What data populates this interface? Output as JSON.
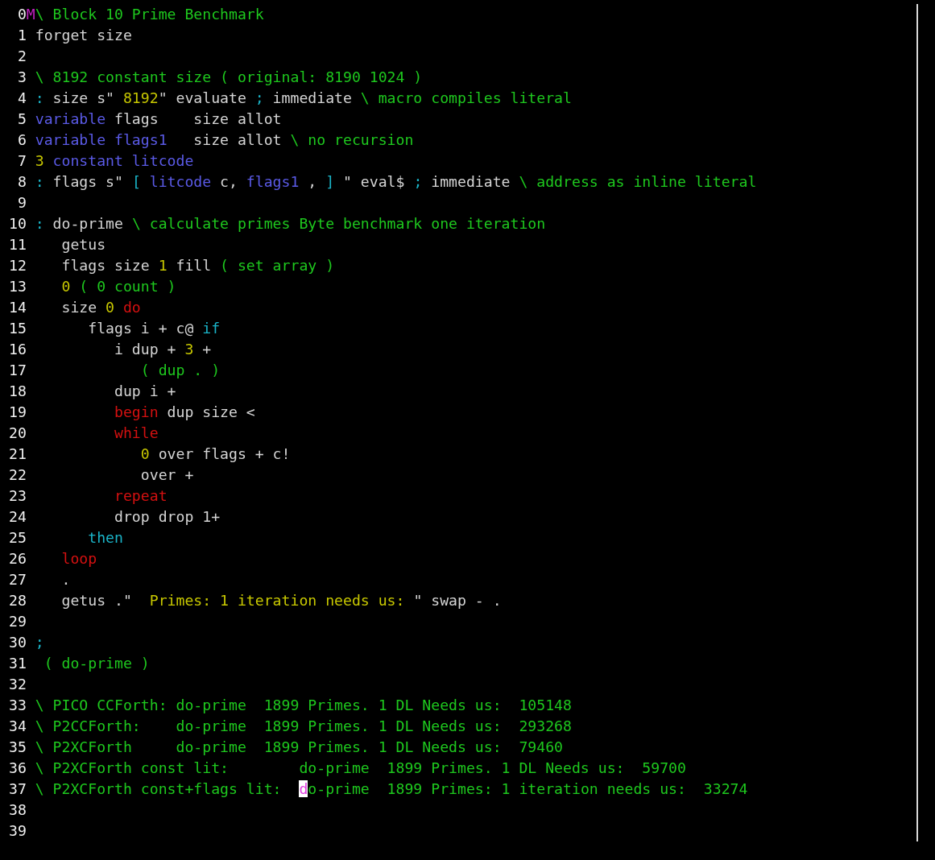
{
  "lines": [
    {
      "number": "0",
      "mark": "M",
      "segments": [
        {
          "text": "\\ Block 10 Prime Benchmark",
          "kind": "comment",
          "cursor": false
        }
      ]
    },
    {
      "number": "1",
      "segments": [
        {
          "text": "forget size",
          "kind": "word",
          "cursor": false
        }
      ]
    },
    {
      "number": "2"
    },
    {
      "number": "3",
      "segments": [
        {
          "text": "\\ 8192 constant size ( original: 8190 1024 )",
          "kind": "comment",
          "cursor": false
        }
      ]
    },
    {
      "number": "4",
      "segments": [
        {
          "text": ":",
          "kind": "structure",
          "cursor": false
        },
        {
          "text": " size s\" ",
          "kind": "word",
          "cursor": false
        },
        {
          "text": "8192",
          "kind": "number",
          "cursor": false
        },
        {
          "text": "\" evaluate ",
          "kind": "word",
          "cursor": false
        },
        {
          "text": ";",
          "kind": "structure",
          "cursor": false
        },
        {
          "text": " immediate ",
          "kind": "word",
          "cursor": false
        },
        {
          "text": "\\ macro compiles literal",
          "kind": "comment",
          "cursor": false
        }
      ]
    },
    {
      "number": "5",
      "segments": [
        {
          "text": "variable",
          "kind": "defining",
          "cursor": false
        },
        {
          "text": " flags    size allot",
          "kind": "word",
          "cursor": false
        }
      ]
    },
    {
      "number": "6",
      "segments": [
        {
          "text": "variable flags1",
          "kind": "defining",
          "cursor": false
        },
        {
          "text": "   size allot ",
          "kind": "word",
          "cursor": false
        },
        {
          "text": "\\ no recursion",
          "kind": "comment",
          "cursor": false
        }
      ]
    },
    {
      "number": "7",
      "segments": [
        {
          "text": "3 ",
          "kind": "number",
          "cursor": false
        },
        {
          "text": "constant litcode",
          "kind": "defining",
          "cursor": false
        }
      ]
    },
    {
      "number": "8",
      "segments": [
        {
          "text": ":",
          "kind": "structure",
          "cursor": false
        },
        {
          "text": " flags s\" ",
          "kind": "word",
          "cursor": false
        },
        {
          "text": "[ ",
          "kind": "structure",
          "cursor": false
        },
        {
          "text": "litcode",
          "kind": "defining",
          "cursor": false
        },
        {
          "text": " c, ",
          "kind": "word",
          "cursor": false
        },
        {
          "text": "flags1",
          "kind": "defining",
          "cursor": false
        },
        {
          "text": " , ",
          "kind": "word",
          "cursor": false
        },
        {
          "text": "]",
          "kind": "structure",
          "cursor": false
        },
        {
          "text": " \" eval$ ",
          "kind": "word",
          "cursor": false
        },
        {
          "text": ";",
          "kind": "structure",
          "cursor": false
        },
        {
          "text": " immediate ",
          "kind": "word",
          "cursor": false
        },
        {
          "text": "\\ address as inline literal",
          "kind": "comment",
          "cursor": false
        }
      ]
    },
    {
      "number": "9"
    },
    {
      "number": "10",
      "segments": [
        {
          "text": ":",
          "kind": "structure",
          "cursor": false
        },
        {
          "text": " do-prime ",
          "kind": "word",
          "cursor": false
        },
        {
          "text": "\\ calculate primes Byte benchmark one iteration",
          "kind": "comment",
          "cursor": false
        }
      ]
    },
    {
      "number": "11",
      "segments": [
        {
          "text": "   getus",
          "kind": "word",
          "cursor": false
        }
      ]
    },
    {
      "number": "12",
      "segments": [
        {
          "text": "   flags size ",
          "kind": "word",
          "cursor": false
        },
        {
          "text": "1",
          "kind": "number",
          "cursor": false
        },
        {
          "text": " fill ",
          "kind": "word",
          "cursor": false
        },
        {
          "text": "( set array )",
          "kind": "comment",
          "cursor": false
        }
      ]
    },
    {
      "number": "13",
      "segments": [
        {
          "text": "   0 ",
          "kind": "number",
          "cursor": false
        },
        {
          "text": "( 0 count )",
          "kind": "comment",
          "cursor": false
        }
      ]
    },
    {
      "number": "14",
      "segments": [
        {
          "text": "   size ",
          "kind": "word",
          "cursor": false
        },
        {
          "text": "0 ",
          "kind": "number",
          "cursor": false
        },
        {
          "text": "do",
          "kind": "control",
          "cursor": false
        }
      ]
    },
    {
      "number": "15",
      "segments": [
        {
          "text": "      flags i + c@ ",
          "kind": "word",
          "cursor": false
        },
        {
          "text": "if",
          "kind": "structure",
          "cursor": false
        }
      ]
    },
    {
      "number": "16",
      "segments": [
        {
          "text": "         i dup + ",
          "kind": "word",
          "cursor": false
        },
        {
          "text": "3",
          "kind": "number",
          "cursor": false
        },
        {
          "text": " +",
          "kind": "word",
          "cursor": false
        }
      ]
    },
    {
      "number": "17",
      "segments": [
        {
          "text": "            ( dup . )",
          "kind": "comment",
          "cursor": false
        }
      ]
    },
    {
      "number": "18",
      "segments": [
        {
          "text": "         dup i +",
          "kind": "word",
          "cursor": false
        }
      ]
    },
    {
      "number": "19",
      "segments": [
        {
          "text": "         begin",
          "kind": "control",
          "cursor": false
        },
        {
          "text": " dup size <",
          "kind": "word",
          "cursor": false
        }
      ]
    },
    {
      "number": "20",
      "segments": [
        {
          "text": "         while",
          "kind": "control",
          "cursor": false
        }
      ]
    },
    {
      "number": "21",
      "segments": [
        {
          "text": "            0",
          "kind": "number",
          "cursor": false
        },
        {
          "text": " over flags + c!",
          "kind": "word",
          "cursor": false
        }
      ]
    },
    {
      "number": "22",
      "segments": [
        {
          "text": "            over +",
          "kind": "word",
          "cursor": false
        }
      ]
    },
    {
      "number": "23",
      "segments": [
        {
          "text": "         repeat",
          "kind": "control",
          "cursor": false
        }
      ]
    },
    {
      "number": "24",
      "segments": [
        {
          "text": "         drop drop 1+",
          "kind": "word",
          "cursor": false
        }
      ]
    },
    {
      "number": "25",
      "segments": [
        {
          "text": "      then",
          "kind": "structure",
          "cursor": false
        }
      ]
    },
    {
      "number": "26",
      "segments": [
        {
          "text": "   loop",
          "kind": "control",
          "cursor": false
        }
      ]
    },
    {
      "number": "27",
      "segments": [
        {
          "text": "   .",
          "kind": "word",
          "cursor": false
        }
      ]
    },
    {
      "number": "28",
      "segments": [
        {
          "text": "   getus .\" ",
          "kind": "word",
          "cursor": false
        },
        {
          "text": " Primes: 1 iteration needs us: ",
          "kind": "string",
          "cursor": false
        },
        {
          "text": "\" swap - .",
          "kind": "word",
          "cursor": false
        }
      ]
    },
    {
      "number": "29"
    },
    {
      "number": "30",
      "segments": [
        {
          "text": ";",
          "kind": "structure",
          "cursor": false
        }
      ]
    },
    {
      "number": "31",
      "segments": [
        {
          "text": " ( do-prime )",
          "kind": "comment",
          "cursor": false
        }
      ]
    },
    {
      "number": "32"
    },
    {
      "number": "33",
      "segments": [
        {
          "text": "\\ PICO CCForth: do-prime  1899 Primes. 1 DL Needs us:  105148",
          "kind": "comment",
          "cursor": false
        }
      ]
    },
    {
      "number": "34",
      "segments": [
        {
          "text": "\\ P2CCForth:    do-prime  1899 Primes. 1 DL Needs us:  293268",
          "kind": "comment",
          "cursor": false
        }
      ]
    },
    {
      "number": "35",
      "segments": [
        {
          "text": "\\ P2XCForth     do-prime  1899 Primes. 1 DL Needs us:  79460",
          "kind": "comment",
          "cursor": false
        }
      ]
    },
    {
      "number": "36",
      "segments": [
        {
          "text": "\\ P2XCForth const lit:        do-prime  1899 Primes. 1 DL Needs us:  59700",
          "kind": "comment",
          "cursor": false
        }
      ]
    },
    {
      "number": "37",
      "segments": [
        {
          "text": "\\ P2XCForth const+flags lit:  ",
          "kind": "comment",
          "cursor": false
        },
        {
          "text": "d",
          "kind": "comment",
          "cursor": true
        },
        {
          "text": "o-prime  1899 Primes: 1 iteration needs us:  33274",
          "kind": "comment",
          "cursor": false
        }
      ]
    },
    {
      "number": "38"
    },
    {
      "number": "39"
    }
  ]
}
